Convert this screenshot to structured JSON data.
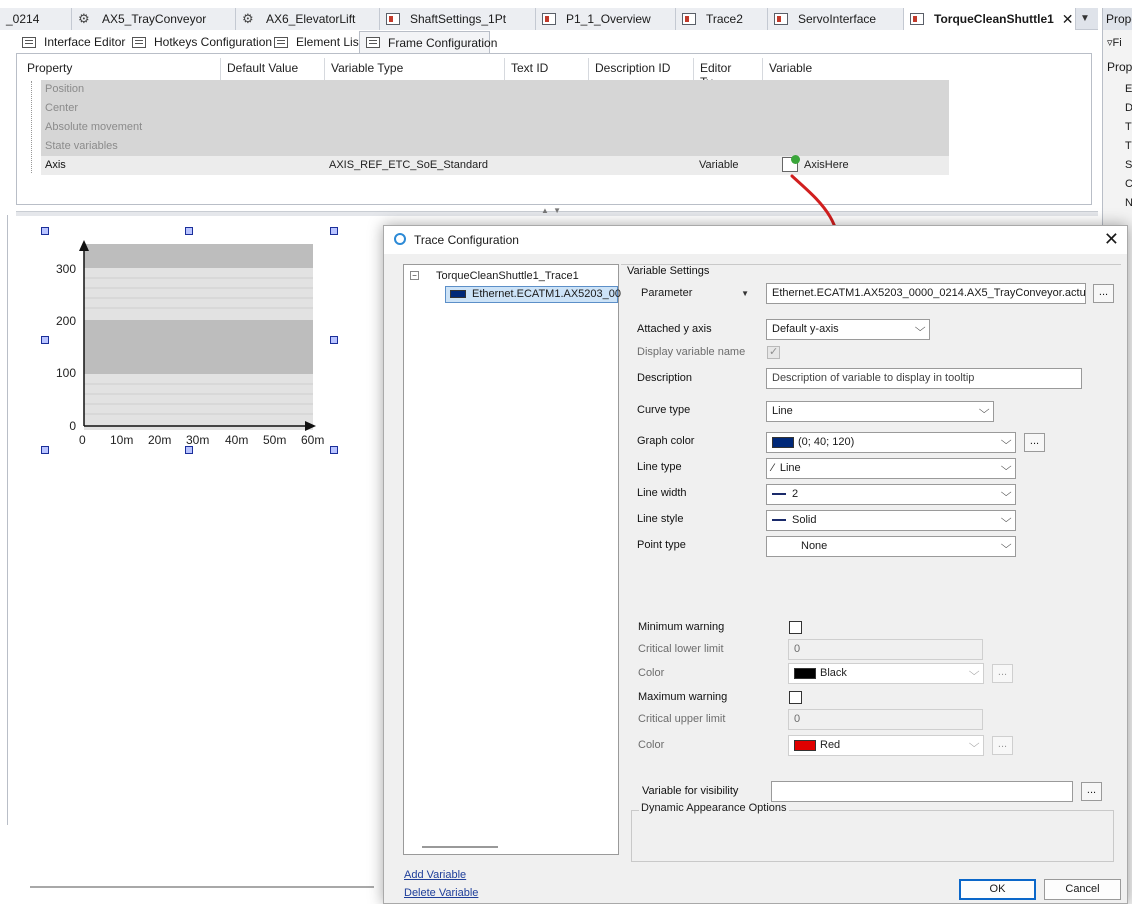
{
  "tabs": [
    {
      "label": "_0214"
    },
    {
      "label": "AX5_TrayConveyor"
    },
    {
      "label": "AX6_ElevatorLift"
    },
    {
      "label": "ShaftSettings_1Pt"
    },
    {
      "label": "P1_1_Overview"
    },
    {
      "label": "Trace2"
    },
    {
      "label": "ServoInterface"
    },
    {
      "label": "TorqueCleanShuttle1"
    }
  ],
  "right_pane": {
    "title": "Prope",
    "filter": "Fi",
    "prop_label": "Prop",
    "rows": [
      "E",
      "D",
      "T",
      "T",
      "S",
      "C",
      "N"
    ]
  },
  "subtabs": [
    "Interface Editor",
    "Hotkeys Configuration",
    "Element List",
    "Frame Configuration"
  ],
  "grid": {
    "headers": [
      "Property",
      "Default Value",
      "Variable Type",
      "Text ID",
      "Description ID",
      "Editor Ty...",
      "Variable"
    ],
    "disabled_rows": [
      "Position",
      "Center",
      "Absolute movement",
      "State variables"
    ],
    "axis_row": {
      "property": "Axis",
      "variable_type": "AXIS_REF_ETC_SoE_Standard",
      "editor_type": "Variable",
      "variable": "AxisHere"
    }
  },
  "trace_preview": {
    "y_ticks": [
      "300",
      "200",
      "100",
      "0"
    ],
    "x_ticks": [
      "0",
      "10m",
      "20m",
      "30m",
      "40m",
      "50m",
      "60m"
    ]
  },
  "dialog": {
    "title": "Trace Configuration",
    "tree_root": "TorqueCleanShuttle1_Trace1",
    "tree_child": "Ethernet.ECATM1.AX5203_00",
    "section": "Variable Settings",
    "parameter_mode": "Parameter",
    "parameter_value": "Ethernet.ECATM1.AX5203_0000_0214.AX5_TrayConveyor.actu",
    "labels": {
      "attached_y_axis": "Attached y axis",
      "display_variable_name": "Display variable name",
      "description": "Description",
      "curve_type": "Curve type",
      "graph_color": "Graph color",
      "line_type": "Line type",
      "line_width": "Line width",
      "line_style": "Line style",
      "point_type": "Point type",
      "minimum_warning": "Minimum warning",
      "critical_lower_limit": "Critical lower limit",
      "color": "Color",
      "maximum_warning": "Maximum warning",
      "critical_upper_limit": "Critical upper limit",
      "dynamic_appearance": "Dynamic Appearance Options",
      "variable_for_visibility": "Variable for visibility"
    },
    "values": {
      "attached_y_axis": "Default y-axis",
      "description_placeholder": "Description of variable to display in tooltip",
      "curve_type": "Line",
      "graph_color": "(0; 40; 120)",
      "line_type": "Line",
      "line_width": "2",
      "line_style": "Solid",
      "point_type": "None",
      "critical_lower_limit": "0",
      "min_color": "Black",
      "critical_upper_limit": "0",
      "max_color": "Red",
      "variable_for_visibility": ""
    },
    "colors": {
      "graph": "#002878",
      "min": "#000000",
      "max": "#e00000"
    },
    "add_variable": "Add Variable",
    "delete_variable": "Delete Variable",
    "ok": "OK",
    "cancel": "Cancel"
  }
}
